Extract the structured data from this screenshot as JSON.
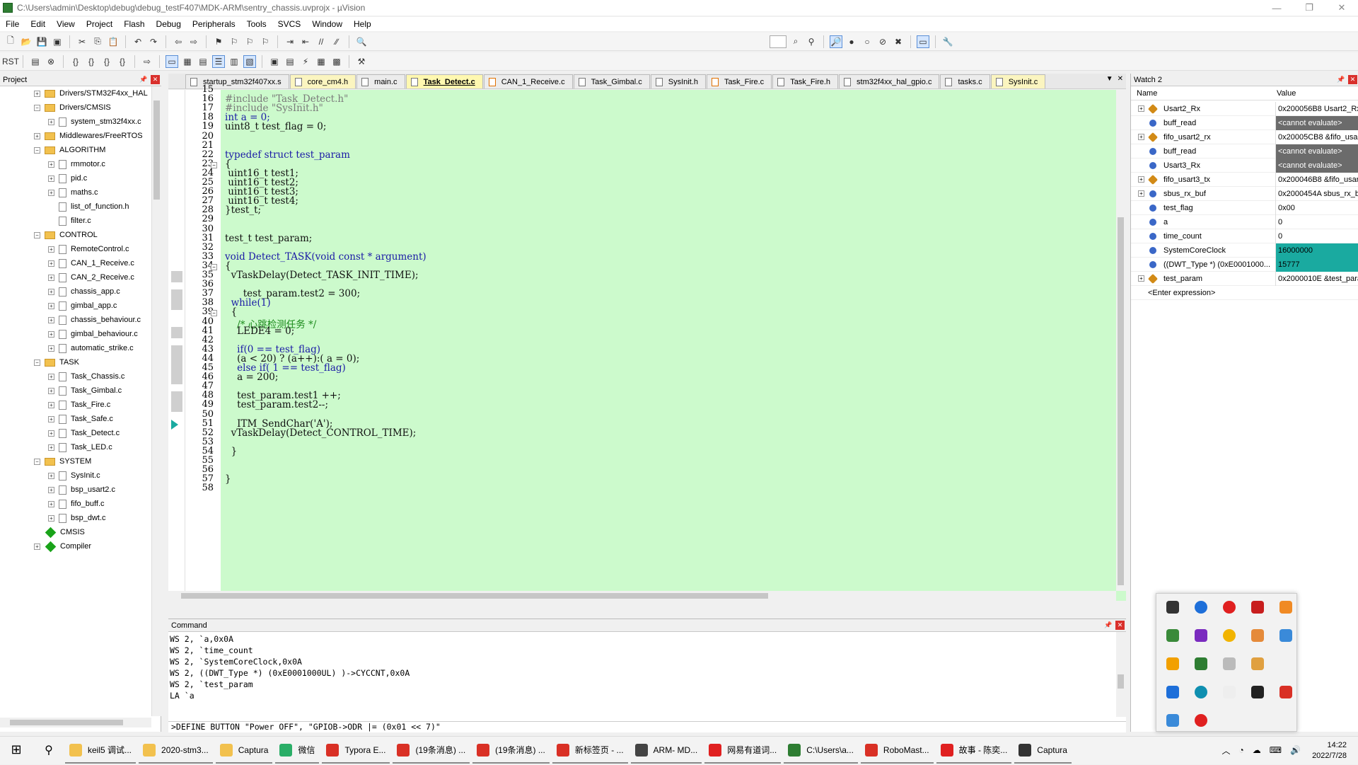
{
  "window": {
    "title": "C:\\Users\\admin\\Desktop\\debug\\debug_testF407\\MDK-ARM\\sentry_chassis.uvprojx - µVision"
  },
  "menu": [
    "File",
    "Edit",
    "View",
    "Project",
    "Flash",
    "Debug",
    "Peripherals",
    "Tools",
    "SVCS",
    "Window",
    "Help"
  ],
  "project_panel": {
    "title": "Project",
    "items": [
      {
        "label": "Drivers/STM32F4xx_HAL",
        "type": "folder",
        "level": 1,
        "expander": "+"
      },
      {
        "label": "Drivers/CMSIS",
        "type": "folder",
        "level": 1,
        "expander": "-"
      },
      {
        "label": "system_stm32f4xx.c",
        "type": "file",
        "level": 2,
        "expander": "+"
      },
      {
        "label": "Middlewares/FreeRTOS",
        "type": "folder",
        "level": 1,
        "expander": "+"
      },
      {
        "label": "ALGORITHM",
        "type": "folder",
        "level": 1,
        "expander": "-"
      },
      {
        "label": "rmmotor.c",
        "type": "file",
        "level": 2,
        "expander": "+"
      },
      {
        "label": "pid.c",
        "type": "file",
        "level": 2,
        "expander": "+"
      },
      {
        "label": "maths.c",
        "type": "file",
        "level": 2,
        "expander": "+"
      },
      {
        "label": "list_of_function.h",
        "type": "file",
        "level": 2,
        "expander": ""
      },
      {
        "label": "filter.c",
        "type": "file",
        "level": 2,
        "expander": ""
      },
      {
        "label": "CONTROL",
        "type": "folder",
        "level": 1,
        "expander": "-"
      },
      {
        "label": "RemoteControl.c",
        "type": "file",
        "level": 2,
        "expander": "+"
      },
      {
        "label": "CAN_1_Receive.c",
        "type": "file",
        "level": 2,
        "expander": "+"
      },
      {
        "label": "CAN_2_Receive.c",
        "type": "file",
        "level": 2,
        "expander": "+"
      },
      {
        "label": "chassis_app.c",
        "type": "file",
        "level": 2,
        "expander": "+"
      },
      {
        "label": "gimbal_app.c",
        "type": "file",
        "level": 2,
        "expander": "+"
      },
      {
        "label": "chassis_behaviour.c",
        "type": "file",
        "level": 2,
        "expander": "+"
      },
      {
        "label": "gimbal_behaviour.c",
        "type": "file",
        "level": 2,
        "expander": "+"
      },
      {
        "label": "automatic_strike.c",
        "type": "file",
        "level": 2,
        "expander": "+"
      },
      {
        "label": "TASK",
        "type": "folder",
        "level": 1,
        "expander": "-"
      },
      {
        "label": "Task_Chassis.c",
        "type": "file",
        "level": 2,
        "expander": "+"
      },
      {
        "label": "Task_Gimbal.c",
        "type": "file",
        "level": 2,
        "expander": "+"
      },
      {
        "label": "Task_Fire.c",
        "type": "file",
        "level": 2,
        "expander": "+"
      },
      {
        "label": "Task_Safe.c",
        "type": "file",
        "level": 2,
        "expander": "+"
      },
      {
        "label": "Task_Detect.c",
        "type": "file",
        "level": 2,
        "expander": "+"
      },
      {
        "label": "Task_LED.c",
        "type": "file",
        "level": 2,
        "expander": "+"
      },
      {
        "label": "SYSTEM",
        "type": "folder",
        "level": 1,
        "expander": "-"
      },
      {
        "label": "SysInit.c",
        "type": "file",
        "level": 2,
        "expander": "+"
      },
      {
        "label": "bsp_usart2.c",
        "type": "file",
        "level": 2,
        "expander": "+"
      },
      {
        "label": "fifo_buff.c",
        "type": "file",
        "level": 2,
        "expander": "+"
      },
      {
        "label": "bsp_dwt.c",
        "type": "file",
        "level": 2,
        "expander": "+"
      },
      {
        "label": "CMSIS",
        "type": "component",
        "level": 1,
        "expander": ""
      },
      {
        "label": "Compiler",
        "type": "component",
        "level": 1,
        "expander": "+"
      }
    ]
  },
  "tabs": [
    {
      "label": "startup_stm32f407xx.s",
      "style": "normal"
    },
    {
      "label": "core_cm4.h",
      "style": "yellow"
    },
    {
      "label": "main.c",
      "style": "normal"
    },
    {
      "label": "Task_Detect.c",
      "style": "active"
    },
    {
      "label": "CAN_1_Receive.c",
      "style": "orange"
    },
    {
      "label": "Task_Gimbal.c",
      "style": "normal"
    },
    {
      "label": "SysInit.h",
      "style": "normal"
    },
    {
      "label": "Task_Fire.c",
      "style": "orange"
    },
    {
      "label": "Task_Fire.h",
      "style": "normal"
    },
    {
      "label": "stm32f4xx_hal_gpio.c",
      "style": "normal"
    },
    {
      "label": "tasks.c",
      "style": "normal"
    },
    {
      "label": "SysInit.c",
      "style": "yellow"
    }
  ],
  "editor": {
    "lines": [
      {
        "n": "15",
        "t": ""
      },
      {
        "n": "16",
        "t": "#include \"Task_Detect.h\""
      },
      {
        "n": "17",
        "t": "#include \"SysInit.h\""
      },
      {
        "n": "18",
        "t": "int a = 0;"
      },
      {
        "n": "19",
        "t": "uint8_t test_flag = 0;"
      },
      {
        "n": "20",
        "t": ""
      },
      {
        "n": "21",
        "t": ""
      },
      {
        "n": "22",
        "t": "typedef struct test_param"
      },
      {
        "n": "23",
        "t": "{"
      },
      {
        "n": "24",
        "t": " uint16_t test1;"
      },
      {
        "n": "25",
        "t": " uint16_t test2;"
      },
      {
        "n": "26",
        "t": " uint16_t test3;"
      },
      {
        "n": "27",
        "t": " uint16_t test4;"
      },
      {
        "n": "28",
        "t": "}test_t;"
      },
      {
        "n": "29",
        "t": ""
      },
      {
        "n": "30",
        "t": ""
      },
      {
        "n": "31",
        "t": "test_t test_param;"
      },
      {
        "n": "32",
        "t": ""
      },
      {
        "n": "33",
        "t": "void Detect_TASK(void const * argument)"
      },
      {
        "n": "34",
        "t": "{"
      },
      {
        "n": "35",
        "t": "  vTaskDelay(Detect_TASK_INIT_TIME);"
      },
      {
        "n": "36",
        "t": ""
      },
      {
        "n": "37",
        "t": "      test_param.test2 = 300;"
      },
      {
        "n": "38",
        "t": "  while(1)"
      },
      {
        "n": "39",
        "t": "  {"
      },
      {
        "n": "40",
        "t": "    /* 心跳检测任务 */"
      },
      {
        "n": "41",
        "t": "    LEDE4 = 0;"
      },
      {
        "n": "42",
        "t": ""
      },
      {
        "n": "43",
        "t": "    if(0 == test_flag)"
      },
      {
        "n": "44",
        "t": "    (a < 20) ? (a++):( a = 0);"
      },
      {
        "n": "45",
        "t": "    else if( 1 == test_flag)"
      },
      {
        "n": "46",
        "t": "    a = 200;"
      },
      {
        "n": "47",
        "t": ""
      },
      {
        "n": "48",
        "t": "    test_param.test1 ++;"
      },
      {
        "n": "49",
        "t": "    test_param.test2--;"
      },
      {
        "n": "50",
        "t": ""
      },
      {
        "n": "51",
        "t": "    ITM_SendChar('A');"
      },
      {
        "n": "52",
        "t": "  vTaskDelay(Detect_CONTROL_TIME);"
      },
      {
        "n": "53",
        "t": ""
      },
      {
        "n": "54",
        "t": "  }"
      },
      {
        "n": "55",
        "t": ""
      },
      {
        "n": "56",
        "t": ""
      },
      {
        "n": "57",
        "t": "}"
      },
      {
        "n": "58",
        "t": ""
      }
    ]
  },
  "watch": {
    "title": "Watch 2",
    "col_name": "Name",
    "col_value": "Value",
    "rows": [
      {
        "name": "Usart2_Rx",
        "value": "0x200056B8 Usart2_Rx",
        "expander": "+",
        "icon": "struct",
        "style": ""
      },
      {
        "name": "buff_read",
        "value": "<cannot evaluate>",
        "expander": "",
        "icon": "var",
        "style": "grey"
      },
      {
        "name": "fifo_usart2_rx",
        "value": "0x20005CB8 &fifo_usart2_rx",
        "expander": "+",
        "icon": "struct",
        "style": ""
      },
      {
        "name": "buff_read",
        "value": "<cannot evaluate>",
        "expander": "",
        "icon": "var",
        "style": "grey"
      },
      {
        "name": "Usart3_Rx",
        "value": "<cannot evaluate>",
        "expander": "",
        "icon": "var",
        "style": "grey"
      },
      {
        "name": "fifo_usart3_tx",
        "value": "0x200046B8 &fifo_usart3_tx",
        "expander": "+",
        "icon": "struct",
        "style": ""
      },
      {
        "name": "sbus_rx_buf",
        "value": "0x2000454A sbus_rx_buf",
        "expander": "+",
        "icon": "var",
        "style": ""
      },
      {
        "name": "test_flag",
        "value": "0x00",
        "expander": "",
        "icon": "var",
        "style": ""
      },
      {
        "name": "a",
        "value": "0",
        "expander": "",
        "icon": "var",
        "style": ""
      },
      {
        "name": "time_count",
        "value": "0",
        "expander": "",
        "icon": "var",
        "style": ""
      },
      {
        "name": "SystemCoreClock",
        "value": "16000000",
        "expander": "",
        "icon": "var",
        "style": "teal"
      },
      {
        "name": "((DWT_Type *) (0xE0001000...",
        "value": "15777",
        "expander": "",
        "icon": "var",
        "style": "teal"
      },
      {
        "name": "test_param",
        "value": "0x2000010E &test_param",
        "expander": "+",
        "icon": "struct",
        "style": ""
      }
    ],
    "enter_expression": "<Enter expression>"
  },
  "command": {
    "title": "Command",
    "lines": [
      "WS 2, `a,0x0A",
      "WS 2, `time_count",
      "WS 2, `SystemCoreClock,0x0A",
      "WS 2, ((DWT_Type *) (0xE0001000UL) )->CYCCNT,0x0A",
      "WS 2, `test_param",
      "LA `a"
    ],
    "input": ">DEFINE BUTTON \"Power OFF\", \"GPIOB->ODR |= (0x01 << 7)\""
  },
  "taskbar": {
    "items": [
      {
        "label": "keil5 调试...",
        "color": "#f2c14e"
      },
      {
        "label": "2020-stm3...",
        "color": "#f2c14e"
      },
      {
        "label": "Captura",
        "color": "#f2c14e"
      },
      {
        "label": "微信",
        "color": "#2aae67"
      },
      {
        "label": "Typora E...",
        "color": "#d93025"
      },
      {
        "label": "(19条消息) ...",
        "color": "#d93025"
      },
      {
        "label": "(19条消息) ...",
        "color": "#d93025"
      },
      {
        "label": "新标签页 - ...",
        "color": "#d93025"
      },
      {
        "label": "ARM- MD...",
        "color": "#444444"
      },
      {
        "label": "网易有道词...",
        "color": "#e02020"
      },
      {
        "label": "C:\\Users\\a...",
        "color": "#2e7d32"
      },
      {
        "label": "RoboMast...",
        "color": "#d93025"
      },
      {
        "label": "故事 - 陈奕...",
        "color": "#e02020"
      },
      {
        "label": "Captura",
        "color": "#333333"
      }
    ],
    "time": "14:22",
    "date": "2022/7/28"
  },
  "colors": {
    "editor_bg": "#ccfacc",
    "keyword": "#1a1aa6",
    "watch_highlight": "#1aaaa0",
    "watch_grey": "#6b6b6b"
  }
}
